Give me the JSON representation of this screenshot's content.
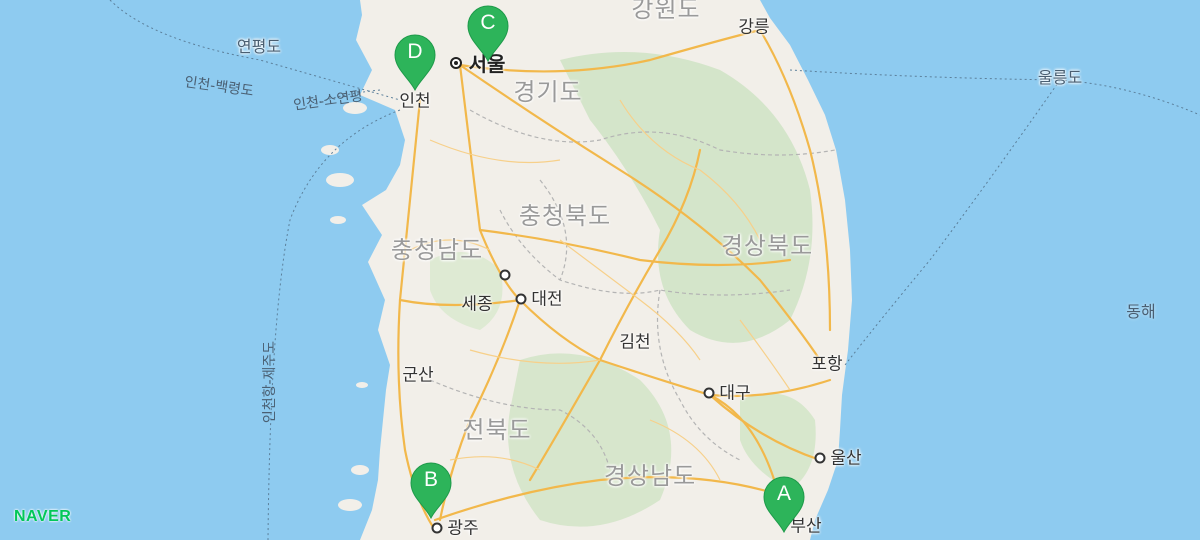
{
  "map": {
    "provinces": [
      "강원도",
      "경기도",
      "충청북도",
      "충청남도",
      "경상북도",
      "전북도",
      "경상남도"
    ],
    "cities": [
      "강릉",
      "서울",
      "인천",
      "세종",
      "대전",
      "김천",
      "포항",
      "군산",
      "대구",
      "울산",
      "광주",
      "부산"
    ],
    "islands": [
      "연평도",
      "울릉도"
    ],
    "sea": "동해",
    "ferry_routes": [
      "인천-백령도",
      "인천-소연평",
      "인천항-제주도"
    ],
    "markers": [
      {
        "letter": "A",
        "place": "부산"
      },
      {
        "letter": "B",
        "place": "광주"
      },
      {
        "letter": "C",
        "place": "서울"
      },
      {
        "letter": "D",
        "place": "인천"
      }
    ],
    "marker_color": "#2db45a",
    "colors": {
      "sea": "#8ecbf0",
      "land": "#f2efe9",
      "forest": "#cfe3c4",
      "road": "#f2b84b"
    }
  },
  "brand": {
    "logo": "NAVER",
    "color": "#03c75a"
  }
}
